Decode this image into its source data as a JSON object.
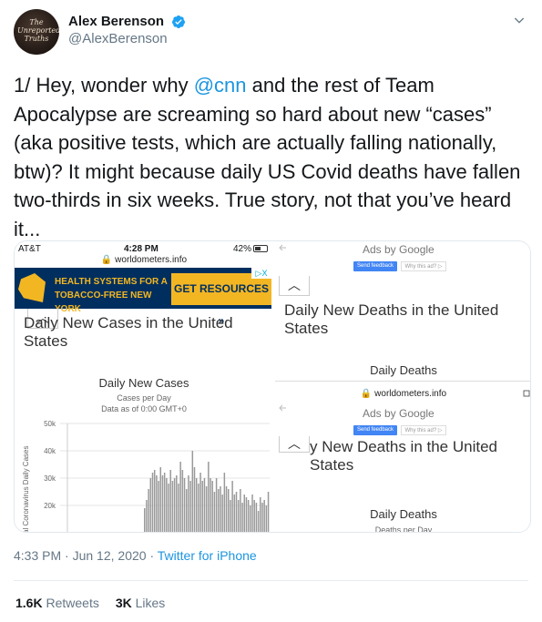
{
  "author": {
    "display_name": "Alex Berenson",
    "handle": "@AlexBerenson",
    "avatar_text": "The Unreported Truths",
    "verified": true
  },
  "tweet": {
    "text_before": "1/ Hey, wonder why ",
    "mention": "@cnn",
    "text_after": " and the rest of Team Apocalypse are screaming so hard about new “cases” (aka positive tests, which are actually falling nationally, btw)? It might because daily US Covid deaths have fallen two-thirds in six weeks. True story, not that you’ve heard it...",
    "time": "4:33 PM",
    "date": "Jun 12, 2020",
    "separator": "·",
    "source": "Twitter for iPhone"
  },
  "stats": {
    "retweets_count": "1.6K",
    "retweets_label": "Retweets",
    "likes_count": "3K",
    "likes_label": "Likes"
  },
  "media_left": {
    "carrier": "AT&T",
    "clock": "4:28 PM",
    "battery": "42%",
    "url": "worldometers.info",
    "ad_text": "HEALTH SYSTEMS FOR A TOBACCO-FREE NEW YORK",
    "ad_cta": "GET RESOURCES »",
    "ad_choices": "▷X",
    "page_title": "Daily New Cases in the United States",
    "chart_title": "Daily New Cases",
    "chart_subtitle1": "Cases per Day",
    "chart_subtitle2": "Data as of 0:00 GMT+0",
    "y_axis_label": "al Coronavirus Daily Cases"
  },
  "media_right": {
    "ads_by": "Ads by Google",
    "send_feedback": "Send feedback",
    "why_ad": "Why this ad? ▷",
    "page_title": "Daily New Deaths in the United States",
    "chart_title": "Daily Deaths",
    "url": "worldometers.info",
    "overlay_title": "y New Deaths in the United States",
    "overlay_chart_title": "Daily Deaths",
    "overlay_sub": "Deaths per Day"
  },
  "chart_data": {
    "type": "bar",
    "title": "Daily New Cases",
    "subtitle": "Cases per Day",
    "ylabel": "al Coronavirus Daily Cases",
    "y_ticks": [
      "50k",
      "40k",
      "30k",
      "20k"
    ],
    "ylim": [
      10000,
      50000
    ],
    "values": [
      19000,
      22000,
      26000,
      30000,
      32000,
      33000,
      31000,
      29000,
      34000,
      31000,
      32000,
      30000,
      28000,
      33000,
      29000,
      30000,
      31000,
      28000,
      36000,
      33000,
      30000,
      26000,
      31000,
      29000,
      40000,
      34000,
      30000,
      28000,
      32000,
      29000,
      30000,
      27000,
      36000,
      30000,
      29000,
      25000,
      30000,
      26000,
      27000,
      24000,
      32000,
      27000,
      26000,
      22000,
      29000,
      24000,
      25000,
      22000,
      26000,
      21000,
      24000,
      23000,
      22000,
      20000,
      24000,
      22000,
      21000,
      18000,
      23000,
      21000,
      22000,
      20000,
      25000
    ]
  }
}
